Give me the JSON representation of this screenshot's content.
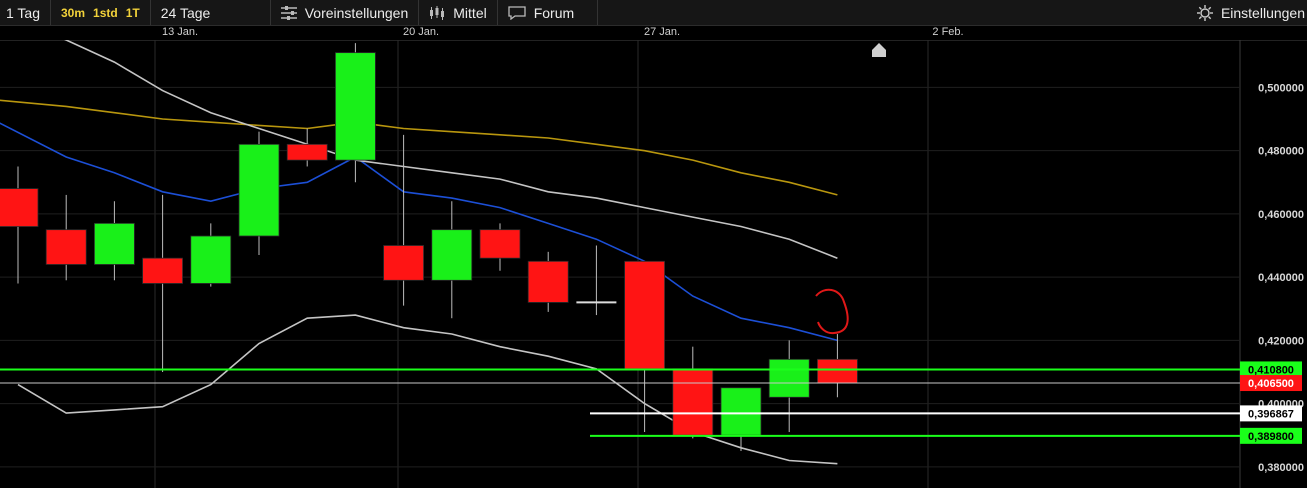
{
  "toolbar": {
    "period": "1 Tag",
    "intervals": [
      "30m",
      "1std",
      "1T"
    ],
    "range": "24 Tage",
    "presets": "Voreinstellungen",
    "indicator": "Mittel",
    "forum": "Forum",
    "settings": "Einstellungen"
  },
  "icons": {
    "presets": "sliders-icon",
    "indicator": "candlestick-icon",
    "forum": "speech-bubble-icon",
    "settings": "gear-icon"
  },
  "colors": {
    "background": "#000000",
    "up_candle": "#19f019",
    "down_candle": "#ff1414",
    "blue_ma": "#1c4fd6",
    "gold_ma": "#b8960e",
    "bollinger": "#c4c4c4",
    "support_line": "#1aff1a",
    "price_line": "#c8c8c8",
    "white_line": "#ffffff",
    "annotation": "#e01818"
  },
  "chart_data": {
    "type": "candlestick",
    "x_labels": [
      "13 Jan.",
      "20 Jan.",
      "27 Jan.",
      "2 Feb."
    ],
    "y_ticks": [
      "0,500000",
      "0,480000",
      "0,460000",
      "0,440000",
      "0,420000",
      "0,400000",
      "0,380000"
    ],
    "ylim": [
      0.3733,
      0.515
    ],
    "grid": true,
    "candles": [
      {
        "open": 0.468,
        "high": 0.475,
        "low": 0.438,
        "close": 0.456
      },
      {
        "open": 0.455,
        "high": 0.466,
        "low": 0.439,
        "close": 0.444
      },
      {
        "open": 0.444,
        "high": 0.464,
        "low": 0.439,
        "close": 0.457
      },
      {
        "open": 0.446,
        "high": 0.466,
        "low": 0.41,
        "close": 0.438
      },
      {
        "open": 0.438,
        "high": 0.457,
        "low": 0.437,
        "close": 0.453
      },
      {
        "open": 0.453,
        "high": 0.486,
        "low": 0.447,
        "close": 0.482
      },
      {
        "open": 0.482,
        "high": 0.487,
        "low": 0.475,
        "close": 0.477
      },
      {
        "open": 0.477,
        "high": 0.514,
        "low": 0.47,
        "close": 0.511
      },
      {
        "open": 0.45,
        "high": 0.485,
        "low": 0.431,
        "close": 0.439
      },
      {
        "open": 0.439,
        "high": 0.464,
        "low": 0.427,
        "close": 0.455
      },
      {
        "open": 0.455,
        "high": 0.457,
        "low": 0.442,
        "close": 0.446
      },
      {
        "open": 0.445,
        "high": 0.448,
        "low": 0.429,
        "close": 0.432
      },
      {
        "open": 0.432,
        "high": 0.45,
        "low": 0.428,
        "close": 0.432
      },
      {
        "open": 0.445,
        "high": 0.445,
        "low": 0.391,
        "close": 0.411
      },
      {
        "open": 0.411,
        "high": 0.418,
        "low": 0.389,
        "close": 0.39
      },
      {
        "open": 0.39,
        "high": 0.405,
        "low": 0.385,
        "close": 0.405
      },
      {
        "open": 0.402,
        "high": 0.42,
        "low": 0.391,
        "close": 0.414
      },
      {
        "open": 0.414,
        "high": 0.422,
        "low": 0.402,
        "close": 0.4065
      }
    ],
    "lines": [
      {
        "role": "gold_ma",
        "values": [
          0.496,
          0.494,
          0.492,
          0.49,
          0.489,
          0.488,
          0.487,
          0.489,
          0.487,
          0.486,
          0.485,
          0.484,
          0.482,
          0.48,
          0.477,
          0.473,
          0.47,
          0.466
        ]
      },
      {
        "role": "blue_ma",
        "values": [
          0.489,
          0.478,
          0.473,
          0.467,
          0.464,
          0.468,
          0.47,
          0.478,
          0.467,
          0.465,
          0.462,
          0.457,
          0.452,
          0.445,
          0.434,
          0.427,
          0.424,
          0.42
        ]
      },
      {
        "role": "bollinger_upper",
        "values": [
          0.521,
          0.515,
          0.508,
          0.499,
          0.492,
          0.487,
          0.482,
          0.477,
          0.475,
          0.473,
          0.471,
          0.467,
          0.465,
          0.462,
          0.459,
          0.456,
          0.452,
          0.446
        ]
      },
      {
        "role": "bollinger_lower",
        "values": [
          0.406,
          0.397,
          0.398,
          0.399,
          0.406,
          0.419,
          0.427,
          0.428,
          0.424,
          0.422,
          0.418,
          0.415,
          0.411,
          0.4,
          0.391,
          0.386,
          0.382,
          0.381
        ]
      }
    ],
    "lines_start_index": [
      0,
      0,
      1,
      1
    ],
    "horizontal_lines": [
      {
        "value": 0.4108,
        "label": "0,410800",
        "role": "support_line",
        "from": "left"
      },
      {
        "value": 0.4065,
        "label": "0,406500",
        "role": "price_line",
        "from": "left"
      },
      {
        "value": 0.3969,
        "label": "0,396867",
        "role": "white_line",
        "from": "late"
      },
      {
        "value": 0.3898,
        "label": "0,389800",
        "role": "support_line",
        "from": "late"
      }
    ]
  }
}
